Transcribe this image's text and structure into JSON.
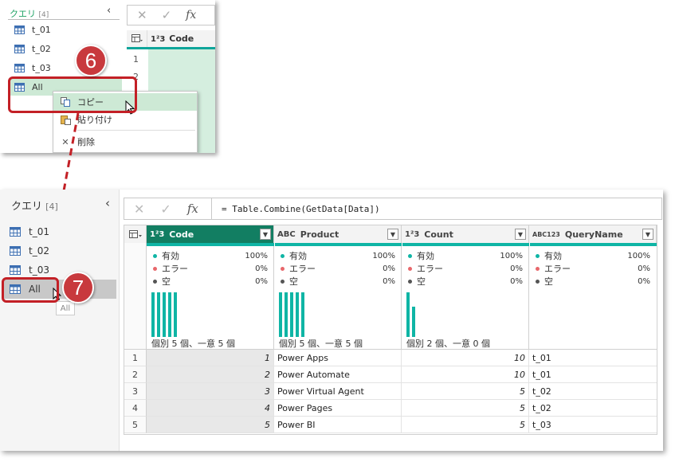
{
  "top": {
    "queries_title": "クエリ",
    "queries_count": "[4]",
    "queries": [
      "t_01",
      "t_02",
      "t_03",
      "All"
    ],
    "column_header": "Code",
    "row_numbers": [
      "1",
      "2"
    ],
    "context_menu": [
      {
        "label": "コピー",
        "icon": "copy-icon"
      },
      {
        "label": "貼り付け",
        "icon": "paste-icon"
      },
      {
        "label": "削除",
        "icon": "delete-icon"
      }
    ],
    "step_badge": "6"
  },
  "main": {
    "queries_title": "クエリ",
    "queries_count": "[4]",
    "queries": [
      "t_01",
      "t_02",
      "t_03",
      "All"
    ],
    "tooltip": "All",
    "step_badge": "7",
    "formula": "= Table.Combine(GetData[Data])",
    "columns": [
      {
        "type": "1²3",
        "name": "Code",
        "valid": "100%",
        "error": "0%",
        "empty": "0%",
        "distinct": "個別 5 個、一意 5 個"
      },
      {
        "type": "ABC",
        "name": "Product",
        "valid": "100%",
        "error": "0%",
        "empty": "0%",
        "distinct": "個別 5 個、一意 5 個"
      },
      {
        "type": "1²3",
        "name": "Count",
        "valid": "100%",
        "error": "0%",
        "empty": "0%",
        "distinct": "個別 2 個、一意 0 個"
      },
      {
        "type": "ABC123",
        "name": "QueryName",
        "valid": "100%",
        "error": "0%",
        "empty": "0%",
        "distinct": ""
      }
    ],
    "profile_labels": {
      "valid": "有効",
      "error": "エラー",
      "empty": "空"
    },
    "rows": [
      {
        "n": "1",
        "code": "1",
        "product": "Power Apps",
        "count": "10",
        "query": "t_01"
      },
      {
        "n": "2",
        "code": "2",
        "product": "Power Automate",
        "count": "10",
        "query": "t_01"
      },
      {
        "n": "3",
        "code": "3",
        "product": "Power Virtual Agent",
        "count": "5",
        "query": "t_02"
      },
      {
        "n": "4",
        "code": "4",
        "product": "Power Pages",
        "count": "5",
        "query": "t_02"
      },
      {
        "n": "5",
        "code": "5",
        "product": "Power BI",
        "count": "5",
        "query": "t_03"
      }
    ],
    "colors": {
      "valid": "#0fb5a5",
      "error": "#e8676b",
      "empty": "#555555",
      "accent": "#127e62",
      "annotation": "#c32026"
    }
  }
}
